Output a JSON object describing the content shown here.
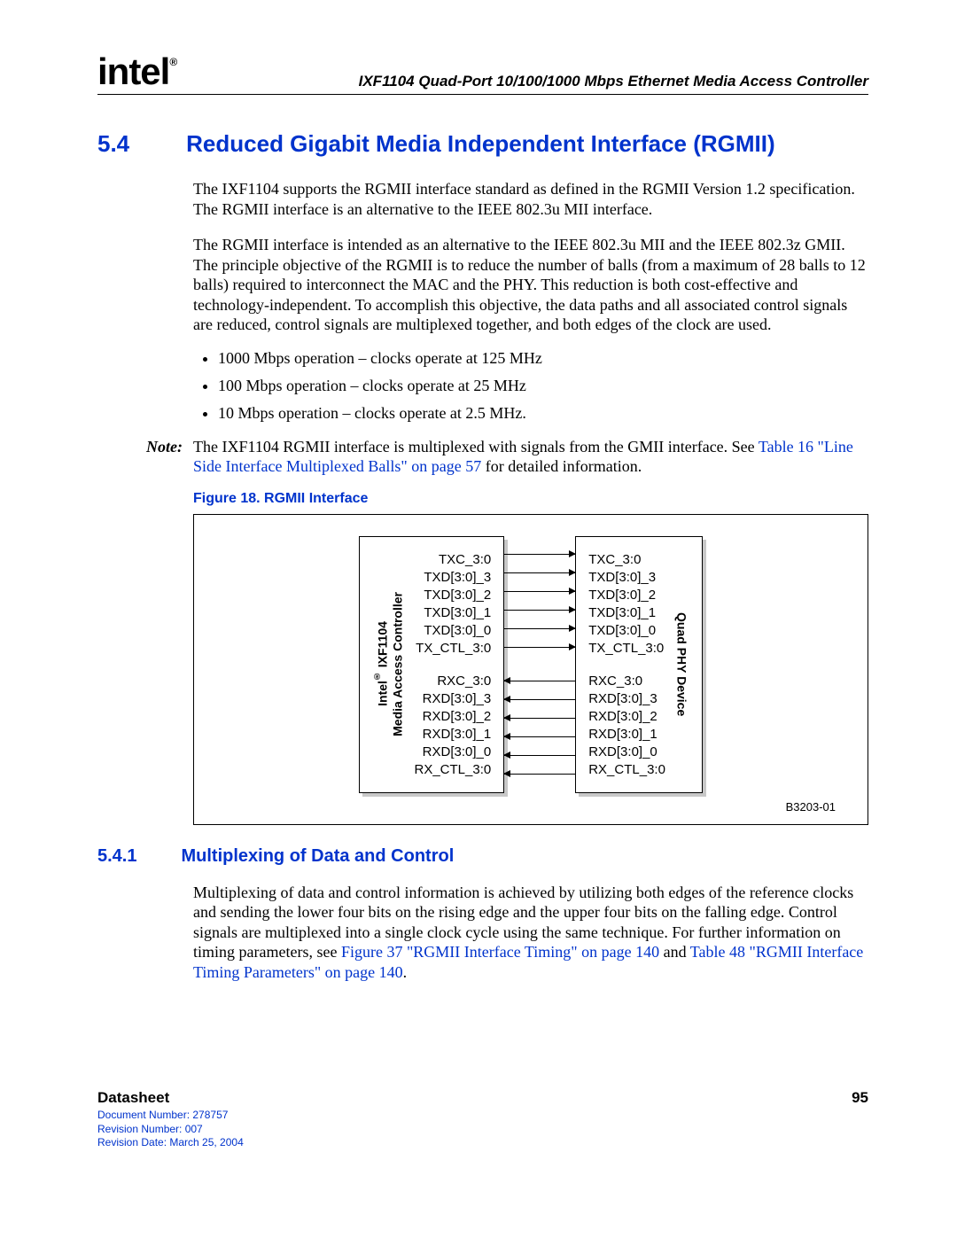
{
  "header": {
    "logo_text": "intel",
    "reg": "®",
    "doc_title": "IXF1104 Quad-Port 10/100/1000 Mbps Ethernet Media Access Controller"
  },
  "section54": {
    "num": "5.4",
    "title": "Reduced Gigabit Media Independent Interface (RGMII)",
    "p1": "The IXF1104 supports the RGMII interface standard as defined in the RGMII Version 1.2 specification. The RGMII interface is an alternative to the IEEE 802.3u MII interface.",
    "p2": "The RGMII interface is intended as an alternative to the IEEE 802.3u MII and the IEEE 802.3z GMII. The principle objective of the RGMII is to reduce the number of balls (from a maximum of 28 balls to 12 balls) required to interconnect the MAC and the PHY. This reduction is both cost-effective and technology-independent. To accomplish this objective, the data paths and all associated control signals are reduced, control signals are multiplexed together, and both edges of the clock are used.",
    "bullets": [
      "1000 Mbps operation – clocks operate at 125 MHz",
      "100 Mbps operation – clocks operate at 25 MHz",
      "10 Mbps operation – clocks operate at 2.5 MHz."
    ],
    "note_label": "Note:",
    "note_pre": "The IXF1104 RGMII interface is multiplexed with signals from the GMII interface. See ",
    "note_link": "Table 16 \"Line Side Interface Multiplexed Balls\" on page 57",
    "note_post": " for detailed information."
  },
  "figure18": {
    "caption": "Figure 18. RGMII Interface",
    "left_block_label": "Intel® IXF1104\nMedia Access Controller",
    "right_block_label": "Quad PHY Device",
    "tx_signals": [
      "TXC_3:0",
      "TXD[3:0]_3",
      "TXD[3:0]_2",
      "TXD[3:0]_1",
      "TXD[3:0]_0",
      "TX_CTL_3:0"
    ],
    "rx_signals": [
      "RXC_3:0",
      "RXD[3:0]_3",
      "RXD[3:0]_2",
      "RXD[3:0]_1",
      "RXD[3:0]_0",
      "RX_CTL_3:0"
    ],
    "fig_id": "B3203-01"
  },
  "section541": {
    "num": "5.4.1",
    "title": "Multiplexing of Data and Control",
    "p1_pre": "Multiplexing of data and control information is achieved by utilizing both edges of the reference clocks and sending the lower four bits on the rising edge and the upper four bits on the falling edge. Control signals are multiplexed into a single clock cycle using the same technique. For further information on timing parameters, see ",
    "link1": "Figure 37 \"RGMII Interface Timing\" on page 140",
    "mid": " and ",
    "link2": "Table 48 \"RGMII Interface Timing Parameters\" on page 140",
    "post": "."
  },
  "footer": {
    "label": "Datasheet",
    "page": "95",
    "docnum": "Document Number: 278757",
    "revnum": "Revision Number: 007",
    "revdate": "Revision Date: March 25, 2004"
  }
}
